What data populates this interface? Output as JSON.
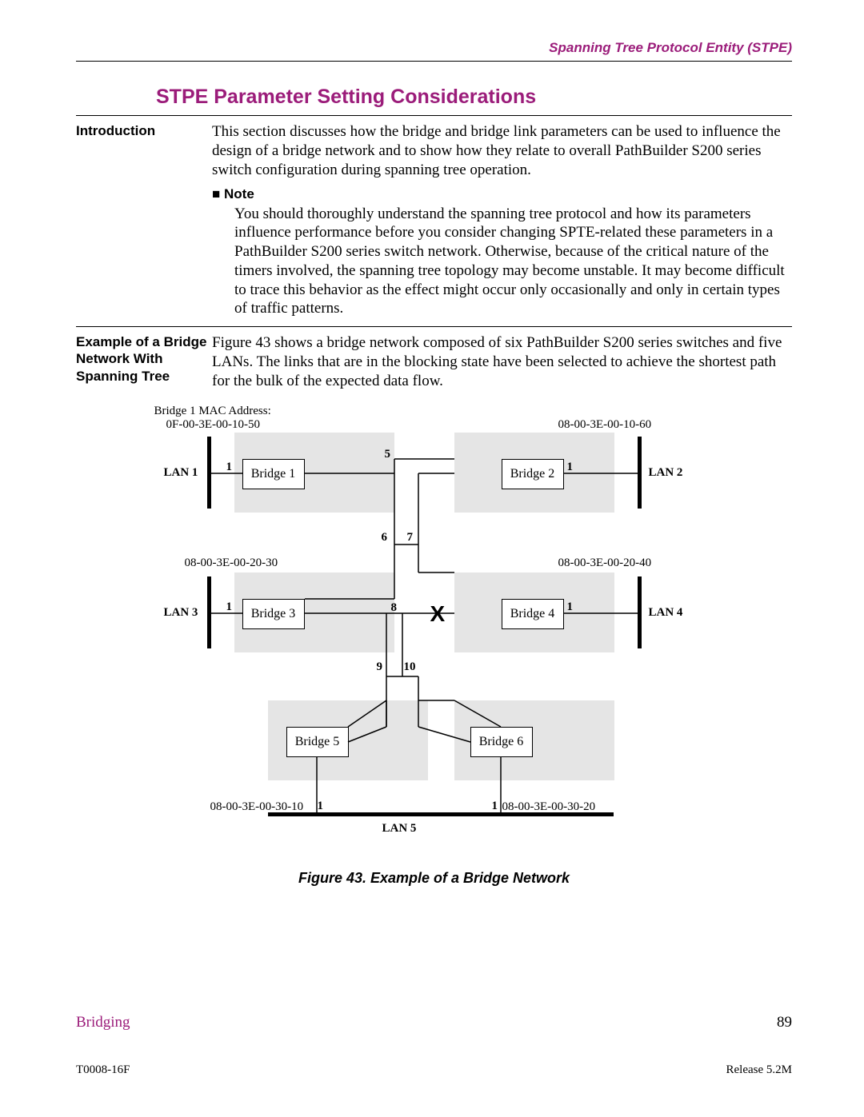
{
  "header": "Spanning Tree Protocol Entity (STPE)",
  "title": "STPE Parameter Setting Considerations",
  "intro": {
    "sidehead": "Introduction",
    "text": "This section discusses how the bridge and bridge link parameters can be used to influence the design of a bridge network and to show how they relate to overall PathBuilder S200 series switch configuration during spanning tree operation.",
    "note_head": "■ Note",
    "note_body": "You should thoroughly understand the spanning tree protocol and how its parameters influence performance before you consider changing SPTE-related these parameters in a PathBuilder S200 series switch network. Otherwise, because of the critical nature of the timers involved, the spanning tree topology may become unstable. It may become difficult to trace this behavior as the effect might occur only occasionally and only in certain types of traffic patterns."
  },
  "example": {
    "sidehead": "Example of a Bridge Network With Spanning Tree",
    "text": "Figure 43 shows a bridge network composed of six PathBuilder S200 series switches and five LANs. The links that are in the blocking state have been selected to achieve the shortest path for the bulk of the expected data flow."
  },
  "caption": "Figure 43. Example of a Bridge Network",
  "footer": {
    "bridging": "Bridging",
    "page": "89",
    "docid": "T0008-16F",
    "release": "Release 5.2M"
  },
  "diagram": {
    "mac_head": "Bridge 1 MAC Address:",
    "b1": "Bridge 1",
    "b2": "Bridge 2",
    "b3": "Bridge 3",
    "b4": "Bridge 4",
    "b5": "Bridge 5",
    "b6": "Bridge 6",
    "lan1": "LAN 1",
    "lan2": "LAN 2",
    "lan3": "LAN 3",
    "lan4": "LAN 4",
    "lan5": "LAN 5",
    "mac1": "0F-00-3E-00-10-50",
    "mac2": "08-00-3E-00-10-60",
    "mac3": "08-00-3E-00-20-30",
    "mac4": "08-00-3E-00-20-40",
    "mac5": "08-00-3E-00-30-10",
    "mac6": "08-00-3E-00-30-20",
    "p1a": "1",
    "p1b": "1",
    "p1c": "1",
    "p1d": "1",
    "p1e": "1",
    "p1f": "1",
    "n5": "5",
    "n6": "6",
    "n7": "7",
    "n8": "8",
    "n9": "9",
    "n10": "10",
    "x": "X"
  }
}
